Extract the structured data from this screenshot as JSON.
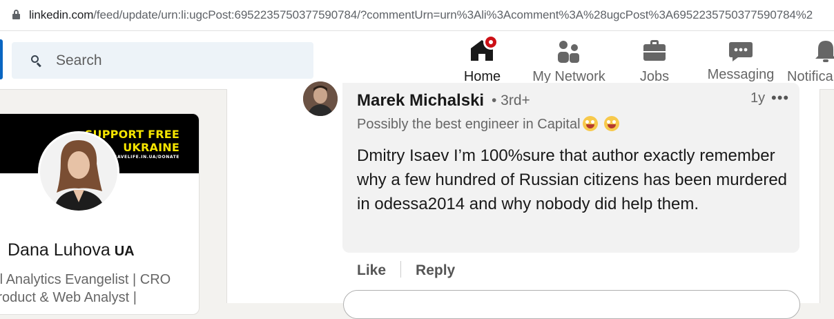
{
  "browser": {
    "url_host": "linkedin.com",
    "url_path": "/feed/update/urn:li:ugcPost:6952235750377590784/?commentUrn=urn%3Ali%3Acomment%3A%28ugcPost%3A6952235750377590784%2"
  },
  "nav": {
    "search_placeholder": "Search",
    "items": [
      {
        "label": "Home",
        "icon": "home-icon",
        "active": true
      },
      {
        "label": "My Network",
        "icon": "people-icon"
      },
      {
        "label": "Jobs",
        "icon": "briefcase-icon"
      },
      {
        "label": "Messaging",
        "icon": "chat-icon"
      },
      {
        "label": "Notifica",
        "icon": "bell-icon"
      }
    ]
  },
  "profile": {
    "banner_line1": "SUPPORT FREE",
    "banner_line2": "UKRAINE",
    "banner_sub": "SAVELIFE.IN.UA/DONATE",
    "name": "Dana Luhova",
    "name_flag": "UA",
    "headline": "tal Analytics Evangelist | CRO Product & Web Analyst |"
  },
  "comment": {
    "author": "Marek Michalski",
    "degree": "• 3rd+",
    "time": "1y",
    "more": "•••",
    "headline": "Possibly the best engineer in Capital",
    "text": "Dmitry Isaev I’m 100%sure that author exactly remember why a few hundred of Russian citizens has been murdered in odessa2014 and why nobody did help them.",
    "like_label": "Like",
    "reply_label": "Reply"
  },
  "colors": {
    "brand_blue": "#0a66c2",
    "notification_red": "#cc1016",
    "banner_yellow": "#f5e400"
  }
}
